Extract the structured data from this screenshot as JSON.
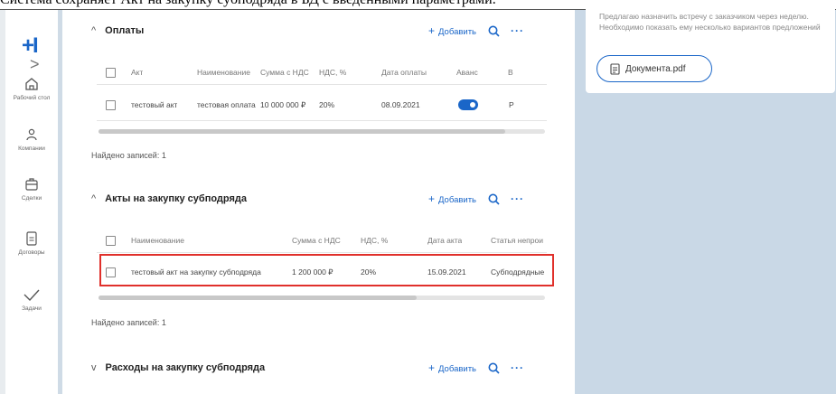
{
  "caption": "Система сохраняет Акт на закупку субподряда в БД с введенными параметрами.",
  "sidebar": {
    "logo": "+I",
    "expand": ">",
    "items": [
      {
        "label": "Рабочий стол",
        "icon": "home-icon"
      },
      {
        "label": "Компании",
        "icon": "people-icon"
      },
      {
        "label": "Сделки",
        "icon": "briefcase-icon"
      },
      {
        "label": "Договоры",
        "icon": "document-icon"
      },
      {
        "label": "Задачи",
        "icon": "check-icon"
      }
    ]
  },
  "comment": {
    "text": "Предлагаю назначить встречу с заказчиком через неделю. Необходимо показать ему несколько вариантов предложений",
    "attachment": "Документа.pdf"
  },
  "sections": {
    "payments": {
      "title": "Оплаты",
      "collapse_icon": "^",
      "add_label": "Добавить",
      "columns": [
        "Акт",
        "Наименование",
        "Сумма с НДС",
        "НДС, %",
        "Дата оплаты",
        "Аванс",
        "В"
      ],
      "rows": [
        {
          "act": "тестовый акт",
          "name": "тестовая оплата",
          "sum": "10 000 000 ₽",
          "vat": "20%",
          "date": "08.09.2021",
          "advance": true,
          "extra": "Р"
        }
      ],
      "found": "Найдено записей: 1"
    },
    "subcontract_acts": {
      "title": "Акты на закупку субподряда",
      "collapse_icon": "^",
      "add_label": "Добавить",
      "columns": [
        "Наименование",
        "Сумма с НДС",
        "НДС, %",
        "Дата акта",
        "Статья непрои"
      ],
      "rows": [
        {
          "name": "тестовый акт на закупку субподряда",
          "sum": "1 200 000 ₽",
          "vat": "20%",
          "date": "15.09.2021",
          "article": "Субподрядные"
        }
      ],
      "found": "Найдено записей: 1"
    },
    "subcontract_costs": {
      "title": "Расходы на закупку субподряда",
      "collapse_icon": "v",
      "add_label": "Добавить"
    }
  },
  "colors": {
    "accent": "#1a66c8",
    "highlight": "#e0302b",
    "panel": "#c9d8e6"
  }
}
